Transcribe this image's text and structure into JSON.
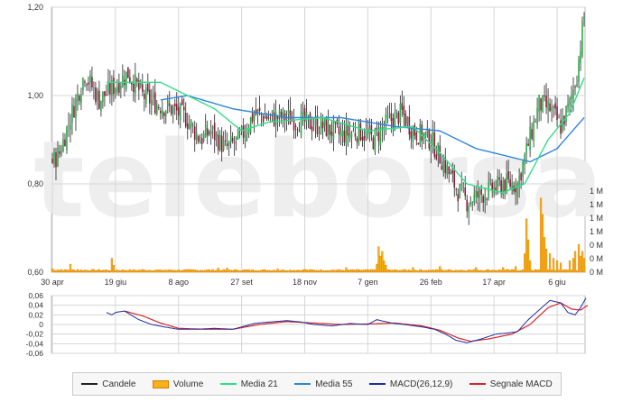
{
  "watermark": "teleborsa",
  "colors": {
    "background": "#ffffff",
    "grid": "#d6d6d6",
    "axis_text": "#333333",
    "candle_up": "#2ba84a",
    "candle_down": "#8b1c3a",
    "candle_wick": "#222222",
    "volume_fill": "#f5b21a",
    "volume_edge": "#e07a00",
    "ma21": "#33dd88",
    "ma55": "#2e86de",
    "macd": "#1f2d9e",
    "signal": "#d6262a",
    "watermark": "#eeeeee"
  },
  "chart_data": [
    {
      "type": "candlestick",
      "x_tick_labels": [
        "30 apr",
        "19 giu",
        "8 ago",
        "27 set",
        "18 nov",
        "7 gen",
        "26 feb",
        "17 apr",
        "6 giu"
      ],
      "y_tick_labels": [
        "0,60",
        "0,80",
        "1,00",
        "1,20"
      ],
      "ylim": [
        0.6,
        1.2
      ],
      "grid": true,
      "volume_axis_labels": [
        "1 M",
        "1 M",
        "1 M",
        "1 M",
        "0 M",
        "0 M",
        "0 M"
      ],
      "price_profile": [
        [
          0,
          0.85
        ],
        [
          4,
          0.87
        ],
        [
          10,
          0.95
        ],
        [
          18,
          1.05
        ],
        [
          26,
          0.99
        ],
        [
          34,
          1.02
        ],
        [
          42,
          1.05
        ],
        [
          50,
          1.0
        ],
        [
          58,
          0.98
        ],
        [
          66,
          0.97
        ],
        [
          74,
          0.95
        ],
        [
          82,
          0.9
        ],
        [
          88,
          0.92
        ],
        [
          96,
          0.88
        ],
        [
          104,
          0.9
        ],
        [
          112,
          0.96
        ],
        [
          120,
          0.95
        ],
        [
          130,
          0.95
        ],
        [
          140,
          0.94
        ],
        [
          150,
          0.93
        ],
        [
          160,
          0.91
        ],
        [
          170,
          0.92
        ],
        [
          178,
          0.9
        ],
        [
          186,
          0.94
        ],
        [
          194,
          0.96
        ],
        [
          200,
          0.92
        ],
        [
          210,
          0.9
        ],
        [
          218,
          0.84
        ],
        [
          224,
          0.79
        ],
        [
          230,
          0.76
        ],
        [
          240,
          0.78
        ],
        [
          250,
          0.8
        ],
        [
          258,
          0.8
        ],
        [
          262,
          0.86
        ],
        [
          266,
          0.92
        ],
        [
          270,
          0.98
        ],
        [
          276,
          0.97
        ],
        [
          282,
          0.93
        ],
        [
          287,
          0.98
        ],
        [
          291,
          1.05
        ],
        [
          295,
          1.18
        ]
      ],
      "ma21": [
        [
          30,
          1.03
        ],
        [
          60,
          1.03
        ],
        [
          90,
          0.97
        ],
        [
          105,
          0.92
        ],
        [
          120,
          0.94
        ],
        [
          150,
          0.95
        ],
        [
          175,
          0.92
        ],
        [
          200,
          0.93
        ],
        [
          215,
          0.87
        ],
        [
          230,
          0.8
        ],
        [
          250,
          0.78
        ],
        [
          262,
          0.8
        ],
        [
          275,
          0.9
        ],
        [
          287,
          0.96
        ],
        [
          295,
          1.04
        ]
      ],
      "ma55": [
        [
          60,
          0.99
        ],
        [
          75,
          1.0
        ],
        [
          100,
          0.97
        ],
        [
          130,
          0.95
        ],
        [
          160,
          0.95
        ],
        [
          190,
          0.93
        ],
        [
          215,
          0.92
        ],
        [
          235,
          0.88
        ],
        [
          255,
          0.86
        ],
        [
          265,
          0.85
        ],
        [
          280,
          0.88
        ],
        [
          295,
          0.95
        ]
      ],
      "volume": [
        [
          0,
          0.15
        ],
        [
          3,
          0.1
        ],
        [
          5,
          0.12
        ],
        [
          8,
          0.1
        ],
        [
          10,
          0.35
        ],
        [
          12,
          0.1
        ],
        [
          14,
          0.12
        ],
        [
          33,
          0.6
        ],
        [
          34,
          0.3
        ],
        [
          50,
          0.12
        ],
        [
          60,
          0.1
        ],
        [
          92,
          0.18
        ],
        [
          97,
          0.18
        ],
        [
          125,
          0.15
        ],
        [
          140,
          0.12
        ],
        [
          163,
          0.2
        ],
        [
          180,
          0.35
        ],
        [
          181,
          1.1
        ],
        [
          182,
          0.7
        ],
        [
          183,
          0.9
        ],
        [
          184,
          0.5
        ],
        [
          185,
          0.3
        ],
        [
          200,
          0.2
        ],
        [
          215,
          0.25
        ],
        [
          235,
          0.2
        ],
        [
          250,
          0.2
        ],
        [
          257,
          0.25
        ],
        [
          262,
          0.8
        ],
        [
          263,
          2.3
        ],
        [
          264,
          1.4
        ],
        [
          265,
          0.5
        ],
        [
          271,
          3.2
        ],
        [
          272,
          2.5
        ],
        [
          273,
          1.5
        ],
        [
          274,
          1.0
        ],
        [
          276,
          0.8
        ],
        [
          278,
          0.6
        ],
        [
          280,
          0.5
        ],
        [
          282,
          0.4
        ],
        [
          287,
          0.5
        ],
        [
          289,
          0.6
        ],
        [
          290,
          0.9
        ],
        [
          292,
          1.2
        ],
        [
          293,
          0.7
        ],
        [
          294,
          0.9
        ],
        [
          295,
          0.6
        ]
      ],
      "volume_scale": [
        0,
        3.5
      ]
    },
    {
      "type": "line",
      "y_tick_labels": [
        "0,06",
        "0,04",
        "0,02",
        "0",
        "-0,02",
        "-0,04",
        "-0,06"
      ],
      "ylim": [
        -0.06,
        0.06
      ],
      "grid": true,
      "macd": [
        [
          30,
          0.025
        ],
        [
          33,
          0.02
        ],
        [
          35,
          0.025
        ],
        [
          40,
          0.028
        ],
        [
          48,
          0.01
        ],
        [
          55,
          0.0
        ],
        [
          62,
          -0.005
        ],
        [
          70,
          -0.01
        ],
        [
          80,
          -0.01
        ],
        [
          90,
          -0.008
        ],
        [
          100,
          -0.01
        ],
        [
          112,
          0.002
        ],
        [
          120,
          0.005
        ],
        [
          130,
          0.008
        ],
        [
          138,
          0.005
        ],
        [
          145,
          0.0
        ],
        [
          155,
          -0.003
        ],
        [
          165,
          0.002
        ],
        [
          175,
          0.0
        ],
        [
          180,
          0.01
        ],
        [
          188,
          0.003
        ],
        [
          195,
          0.0
        ],
        [
          205,
          -0.005
        ],
        [
          212,
          -0.01
        ],
        [
          218,
          -0.02
        ],
        [
          224,
          -0.033
        ],
        [
          230,
          -0.038
        ],
        [
          238,
          -0.03
        ],
        [
          246,
          -0.02
        ],
        [
          252,
          -0.018
        ],
        [
          258,
          -0.015
        ],
        [
          264,
          0.01
        ],
        [
          270,
          0.03
        ],
        [
          276,
          0.05
        ],
        [
          282,
          0.045
        ],
        [
          286,
          0.025
        ],
        [
          290,
          0.02
        ],
        [
          293,
          0.035
        ],
        [
          296,
          0.055
        ]
      ],
      "signal": [
        [
          40,
          0.028
        ],
        [
          50,
          0.018
        ],
        [
          60,
          0.003
        ],
        [
          70,
          -0.008
        ],
        [
          85,
          -0.01
        ],
        [
          100,
          -0.01
        ],
        [
          115,
          0.0
        ],
        [
          130,
          0.006
        ],
        [
          145,
          0.003
        ],
        [
          160,
          0.0
        ],
        [
          175,
          0.001
        ],
        [
          190,
          0.003
        ],
        [
          205,
          -0.003
        ],
        [
          215,
          -0.012
        ],
        [
          225,
          -0.028
        ],
        [
          232,
          -0.035
        ],
        [
          242,
          -0.03
        ],
        [
          255,
          -0.02
        ],
        [
          265,
          0.0
        ],
        [
          275,
          0.035
        ],
        [
          282,
          0.045
        ],
        [
          288,
          0.032
        ],
        [
          293,
          0.03
        ],
        [
          297,
          0.04
        ]
      ]
    }
  ],
  "legend": [
    {
      "label": "Candele",
      "color": "#222222",
      "kind": "line"
    },
    {
      "label": "Volume",
      "color": "#f5b21a",
      "kind": "box"
    },
    {
      "label": "Media 21",
      "color": "#33dd88",
      "kind": "line"
    },
    {
      "label": "Media 55",
      "color": "#2e86de",
      "kind": "line"
    },
    {
      "label": "MACD(26,12,9)",
      "color": "#1f2d9e",
      "kind": "line"
    },
    {
      "label": "Segnale MACD",
      "color": "#d6262a",
      "kind": "line"
    }
  ]
}
